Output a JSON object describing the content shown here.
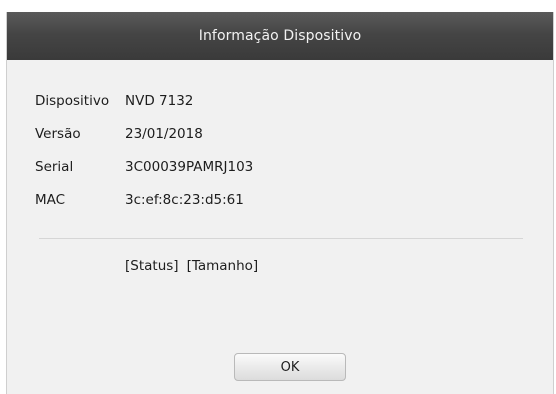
{
  "dialog": {
    "title": "Informação Dispositivo",
    "fields": [
      {
        "label": "Dispositivo",
        "value": "NVD 7132"
      },
      {
        "label": "Versão",
        "value": "23/01/2018"
      },
      {
        "label": "Serial",
        "value": "3C00039PAMRJ103"
      },
      {
        "label": "MAC",
        "value": "3c:ef:8c:23:d5:61"
      }
    ],
    "links": {
      "status": "[Status]",
      "tamanho": "[Tamanho]"
    },
    "ok_label": "OK"
  },
  "colors": {
    "titlebar": "#3e3e3e",
    "title_text": "#f2f2f2",
    "panel_bg": "#f1f1f1",
    "text": "#1d1d1d"
  }
}
